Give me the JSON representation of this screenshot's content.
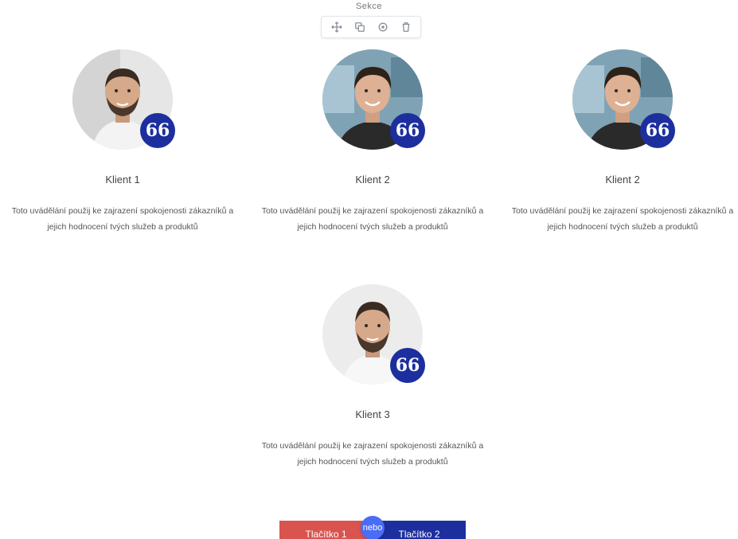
{
  "section": {
    "label": "Sekce"
  },
  "toolbar": {
    "items": [
      {
        "icon": "move-icon"
      },
      {
        "icon": "duplicate-icon"
      },
      {
        "icon": "settings-icon"
      },
      {
        "icon": "delete-icon"
      }
    ]
  },
  "testimonials": [
    {
      "name": "Klient 1",
      "text": "Toto uvádělání použij ke zajrazení spokojenosti zákazníků a jejich hodnocení tvých služeb a produktů",
      "photo": "man-beard-white-shirt"
    },
    {
      "name": "Klient 2",
      "text": "Toto uvádělání použij ke zajrazení spokojenosti zákazníků a jejich hodnocení tvých služeb a produktů",
      "photo": "young-man-dark-tshirt"
    },
    {
      "name": "Klient 2",
      "text": "Toto uvádělání použij ke zajrazení spokojenosti zákazníků a jejich hodnocení tvých služeb a produktů",
      "photo": "young-man-dark-tshirt"
    },
    {
      "name": "Klient 3",
      "text": "Toto uvádělání použij ke zajrazení spokojenosti zákazníků a jejich hodnocení tvých služeb a produktů",
      "photo": "man-beard-white-shirt"
    }
  ],
  "quote_glyph": "66",
  "buttons": {
    "primary_label": "Tlačítko 1",
    "secondary_label": "Tlačítko 2",
    "divider_label": "nebo"
  },
  "colors": {
    "accent": "#1d2f9e",
    "button_red": "#d9534f",
    "divider_blue": "#4a6cf7"
  }
}
